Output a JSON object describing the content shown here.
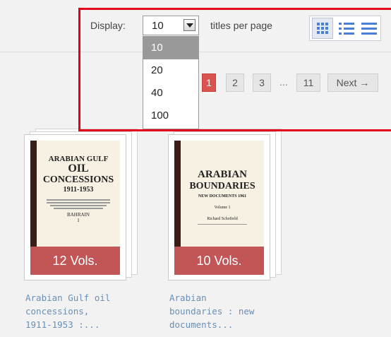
{
  "display": {
    "label": "Display:",
    "selected": "10",
    "titles_label": "titles per page",
    "options": [
      "10",
      "20",
      "40",
      "100"
    ]
  },
  "pagination": {
    "pages": [
      "1",
      "2",
      "3",
      "11"
    ],
    "ellipsis": "...",
    "next": "Next →",
    "current": "1"
  },
  "view_modes": [
    "grid-icon",
    "list-icon",
    "compact-list-icon"
  ],
  "books": [
    {
      "cover": {
        "line1": "ARABIAN GULF",
        "line2": "OIL",
        "line3": "CONCESSIONS",
        "line4": "1911-1953",
        "line5": "BAHRAIN",
        "line6": "1"
      },
      "vols": "12 Vols.",
      "title_lines": [
        "Arabian Gulf oil",
        "concessions,",
        "1911-1953 :..."
      ]
    },
    {
      "cover": {
        "line1": "ARABIAN",
        "line2": "BOUNDARIES",
        "line3": "NEW DOCUMENTS 1961",
        "line4": "Volume 1",
        "line5": "Richard Schofield"
      },
      "vols": "10 Vols.",
      "title_lines": [
        "Arabian",
        "boundaries : new",
        "documents..."
      ]
    }
  ],
  "colors": {
    "accent": "#d9534f",
    "vol_badge": "#c25656",
    "link": "#6a8fb6",
    "highlight": "#e3001b",
    "icon": "#4a7fd6"
  }
}
